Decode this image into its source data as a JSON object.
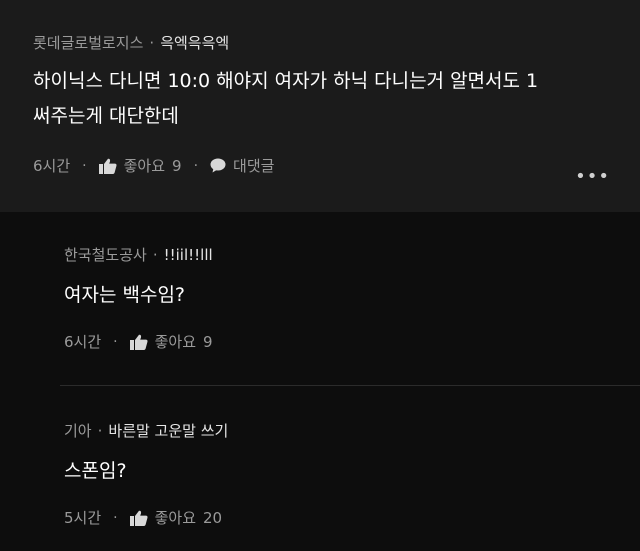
{
  "comments": [
    {
      "author": "롯데글로벌로지스",
      "nickname": "윽엑윽윽엑",
      "text_line1": "하이닉스 다니면 10:0 해야지 여자가 하닉 다니는거 알면서도 1",
      "text_line2": "써주는게 대단한데",
      "time": "6시간",
      "like_label": "좋아요",
      "likes": "9",
      "reply_label": "대댓글"
    }
  ],
  "replies": [
    {
      "author": "한국철도공사",
      "nickname": "!!iil!!lll",
      "text": "여자는 백수임?",
      "time": "6시간",
      "like_label": "좋아요",
      "likes": "9"
    },
    {
      "author": "기아",
      "nickname": "바른말 고운말 쓰기",
      "text": "스폰임?",
      "time": "5시간",
      "like_label": "좋아요",
      "likes": "20"
    }
  ],
  "separator": "·",
  "more_glyph": "•••",
  "icons": {
    "like": "thumbs-up-icon",
    "reply": "speech-bubble-icon",
    "more": "more-dots-icon"
  }
}
